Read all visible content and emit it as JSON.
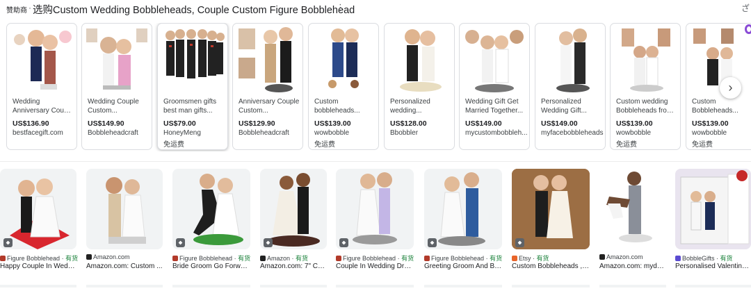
{
  "header": {
    "sponsored": "赞助商",
    "separator": "·",
    "title": "选购Custom Wedding Bobbleheads, Couple Custom Figure Bobblehead",
    "more_icon": "more-vert-icon",
    "corner_label": "ざ"
  },
  "ads": [
    {
      "name1": "Wedding",
      "name2": "Anniversary Coupl...",
      "price": "US$136.90",
      "seller": "bestfacegift.com",
      "ship": ""
    },
    {
      "name1": "Wedding Couple",
      "name2": "Custom...",
      "price": "US$149.90",
      "seller": "Bobbleheadcraft",
      "ship": ""
    },
    {
      "name1": "Groomsmen gifts",
      "name2": "best man gifts...",
      "price": "US$79.00",
      "seller": "HoneyMeng",
      "ship": "免运费"
    },
    {
      "name1": "Anniversary Couple",
      "name2": "Custom...",
      "price": "US$129.90",
      "seller": "Bobbleheadcraft",
      "ship": ""
    },
    {
      "name1": "Custom",
      "name2": "bobbleheads...",
      "price": "US$139.00",
      "seller": "wowbobble",
      "ship": "免运费"
    },
    {
      "name1": "Personalized",
      "name2": "wedding...",
      "price": "US$128.00",
      "seller": "Bbobbler",
      "ship": ""
    },
    {
      "name1": "Wedding Gift Get",
      "name2": "Married Together...",
      "price": "US$149.00",
      "seller": "mycustombobbleh...",
      "ship": ""
    },
    {
      "name1": "Personalized",
      "name2": "Wedding Gift...",
      "price": "US$149.00",
      "seller": "myfacebobbleheads",
      "ship": ""
    },
    {
      "name1": "Custom wedding",
      "name2": "Bobbleheads from...",
      "price": "US$139.00",
      "seller": "wowbobble",
      "ship": "免运费"
    },
    {
      "name1": "Custom",
      "name2": "Bobbleheads...",
      "price": "US$139.00",
      "seller": "wowbobble",
      "ship": "免运费"
    }
  ],
  "next_icon": "chevron-right-icon",
  "results": [
    {
      "source": "Figure Bobblehead",
      "stock": "有货",
      "caption": "Happy Couple In Weddi...",
      "fav_color": "#b23a2a"
    },
    {
      "source": "Amazon.com",
      "stock": "",
      "caption": "Amazon.com: Custom ...",
      "fav_color": "#222222"
    },
    {
      "source": "Figure Bobblehead",
      "stock": "有货",
      "caption": "Bride Groom Go Forwar...",
      "fav_color": "#b23a2a"
    },
    {
      "source": "Amazon",
      "stock": "有货",
      "caption": "Amazon.com: 7\" Cu...",
      "fav_color": "#222222"
    },
    {
      "source": "Figure Bobblehead",
      "stock": "有货",
      "caption": "Couple In Wedding Dres...",
      "fav_color": "#b23a2a"
    },
    {
      "source": "Figure Bobblehead",
      "stock": "有货",
      "caption": "Greeting Groom And Bri...",
      "fav_color": "#b23a2a"
    },
    {
      "source": "Etsy",
      "stock": "有货",
      "caption": "Custom Bobbleheads ,b...",
      "fav_color": "#e8652b"
    },
    {
      "source": "Amazon.com",
      "stock": "",
      "caption": "Amazon.com: myde...",
      "fav_color": "#222222"
    },
    {
      "source": "BobbleGifts",
      "stock": "有货",
      "caption": "Personalised Valentine'...",
      "fav_color": "#5b4bd1"
    }
  ],
  "colors": {
    "accent_green": "#188038",
    "border": "#dadce0",
    "purple": "#8a4bd6"
  }
}
